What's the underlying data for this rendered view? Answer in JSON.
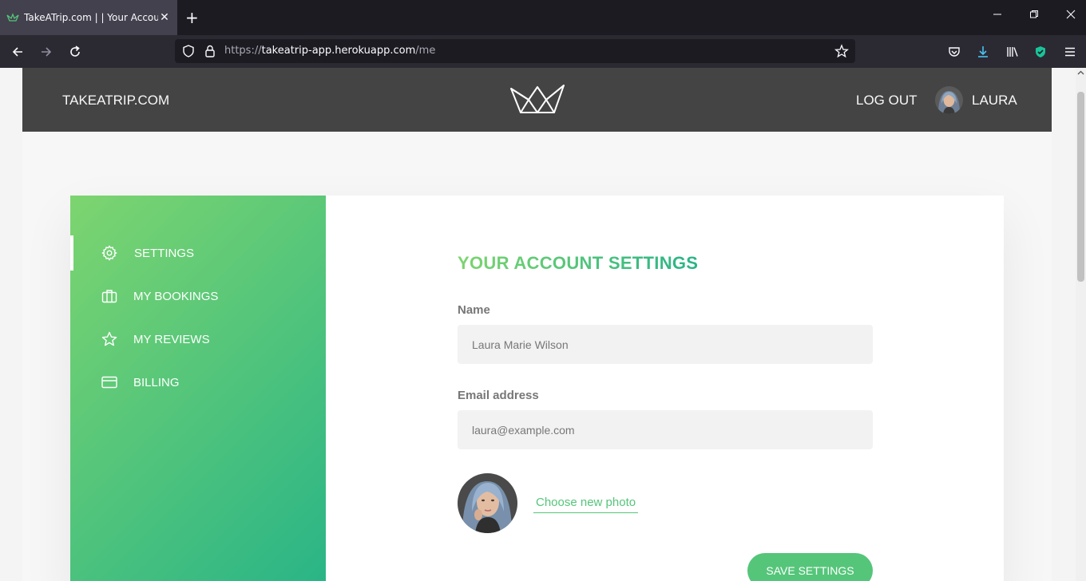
{
  "browser": {
    "tab_title": "TakeATrip.com | | Your Account",
    "url_host": "takeatrip-app.herokuapp.com",
    "url_scheme": "https://",
    "url_path": "/me"
  },
  "header": {
    "brand": "TAKEATRIP.COM",
    "logout_label": "LOG OUT",
    "user_name": "LAURA"
  },
  "sidebar": {
    "items": [
      {
        "label": "SETTINGS",
        "icon": "gear-icon"
      },
      {
        "label": "MY BOOKINGS",
        "icon": "briefcase-icon"
      },
      {
        "label": "MY REVIEWS",
        "icon": "star-icon"
      },
      {
        "label": "BILLING",
        "icon": "credit-card-icon"
      }
    ]
  },
  "settings": {
    "title": "YOUR ACCOUNT SETTINGS",
    "name_label": "Name",
    "name_value": "Laura Marie Wilson",
    "email_label": "Email address",
    "email_value": "laura@example.com",
    "choose_photo_label": "Choose new photo",
    "save_label": "SAVE SETTINGS"
  },
  "colors": {
    "accent": "#55c57a",
    "gradient_start": "#7dd56f",
    "gradient_end": "#28b487",
    "header_bg": "#444444"
  }
}
